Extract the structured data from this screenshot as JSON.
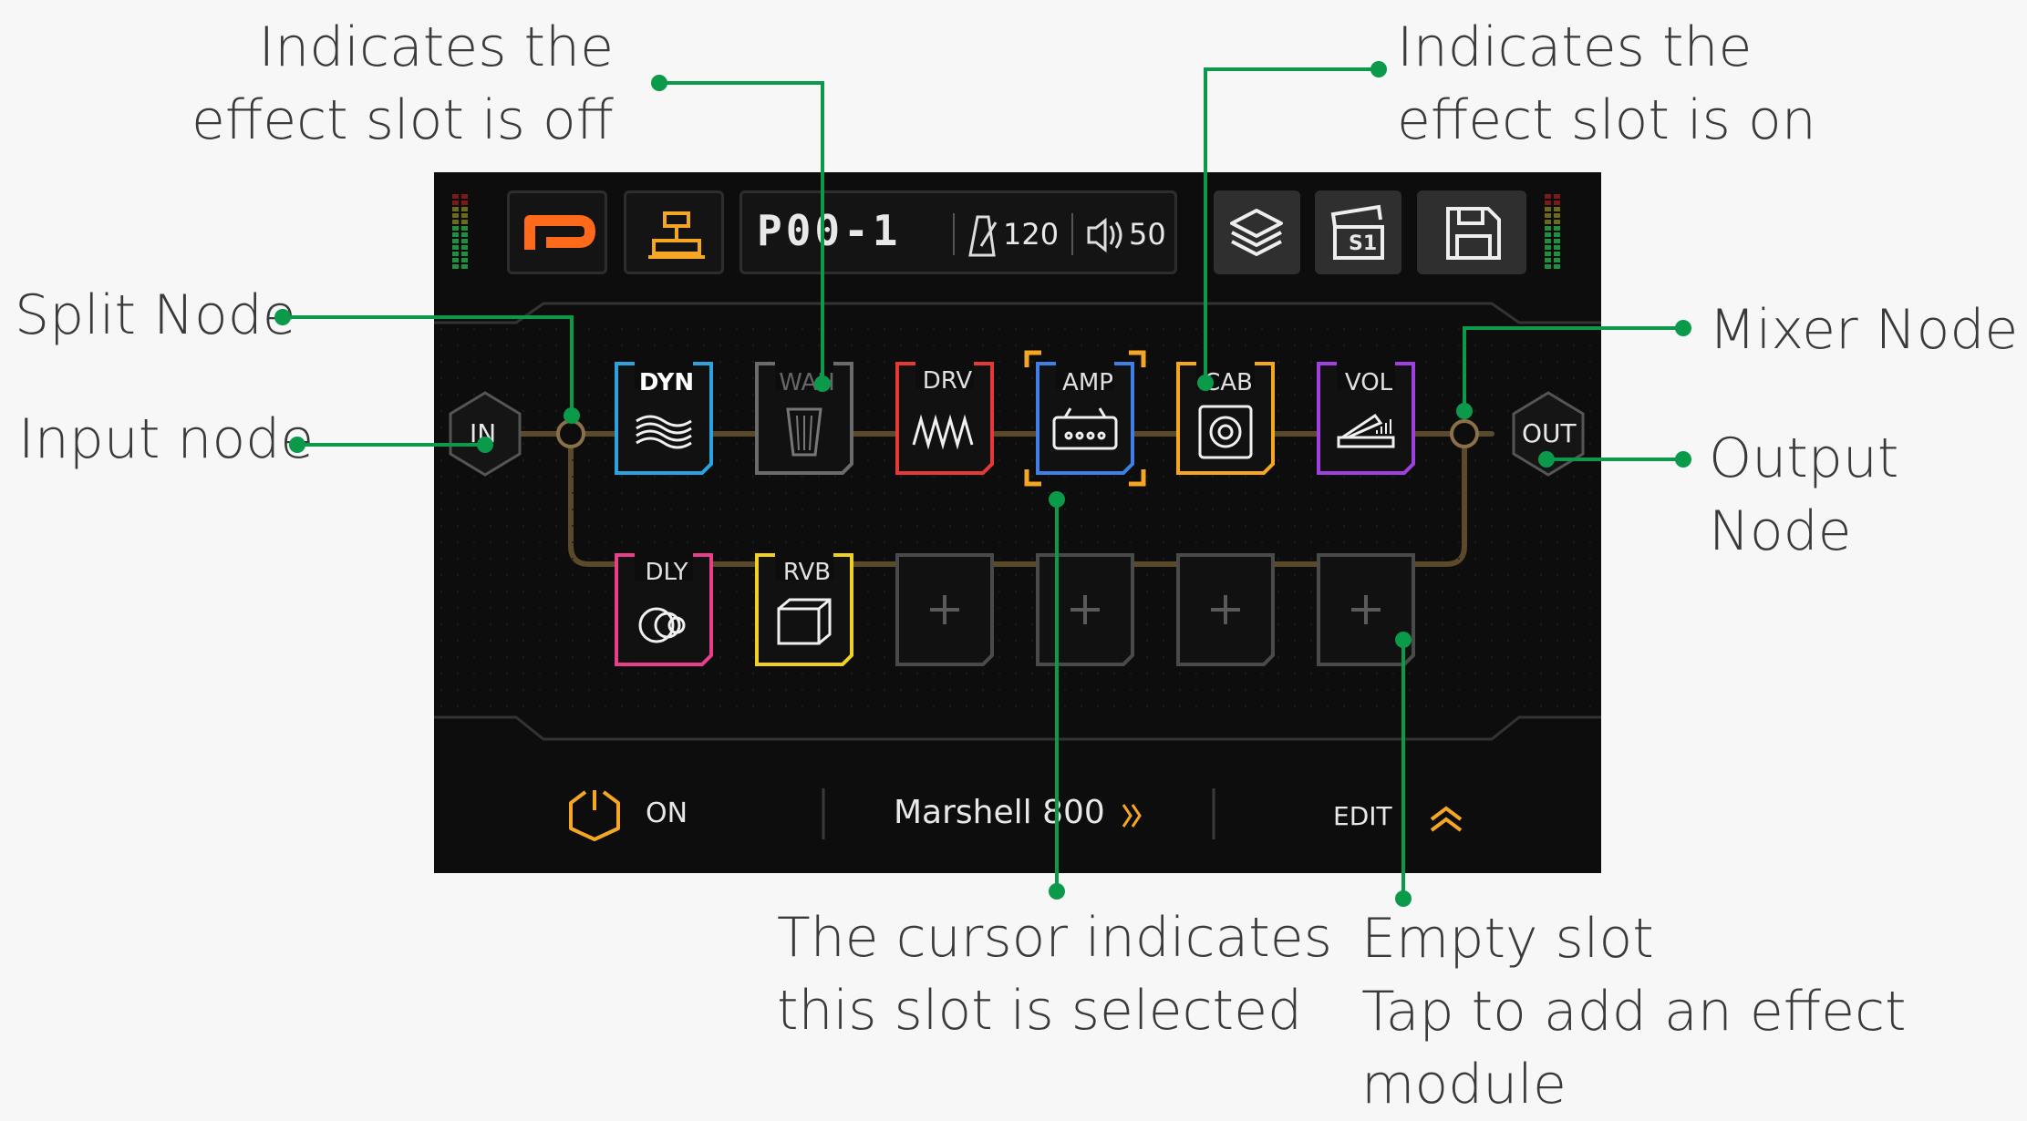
{
  "annotations": {
    "effect_off": "Indicates the\neffect slot is off",
    "effect_on": "Indicates the\neffect slot is on",
    "split_node": "Split Node",
    "input_node": "Input node",
    "mixer_node": "Mixer Node",
    "output_node": "Output Node",
    "cursor": "The cursor indicates\nthis slot is selected",
    "empty_slot": "Empty slot\nTap to add an effect\nmodule"
  },
  "header": {
    "preset_name": "P00-1",
    "bpm": "120",
    "volume": "50",
    "scene_label": "S1"
  },
  "nodes": {
    "input": "IN",
    "output": "OUT"
  },
  "slots_row1": [
    {
      "label": "DYN",
      "color": "#2aa3e0",
      "state": "on"
    },
    {
      "label": "WAH",
      "color": "#6b6b6b",
      "state": "off"
    },
    {
      "label": "DRV",
      "color": "#e53935",
      "state": "on"
    },
    {
      "label": "AMP",
      "color": "#3f7fe6",
      "state": "selected"
    },
    {
      "label": "CAB",
      "color": "#f5a623",
      "state": "on"
    },
    {
      "label": "VOL",
      "color": "#a040e0",
      "state": "on"
    }
  ],
  "slots_row2": [
    {
      "label": "DLY",
      "color": "#e83e8c",
      "state": "on"
    },
    {
      "label": "RVB",
      "color": "#f0d020",
      "state": "on"
    },
    {
      "label": "",
      "state": "empty"
    },
    {
      "label": "",
      "state": "empty"
    },
    {
      "label": "",
      "state": "empty"
    },
    {
      "label": "",
      "state": "empty"
    }
  ],
  "footer": {
    "power_label": "ON",
    "module_name": "Marshell 800",
    "edit_label": "EDIT"
  },
  "colors": {
    "accent": "#f5a623",
    "leader": "#0a9a4a",
    "path": "#5a4a2a"
  }
}
